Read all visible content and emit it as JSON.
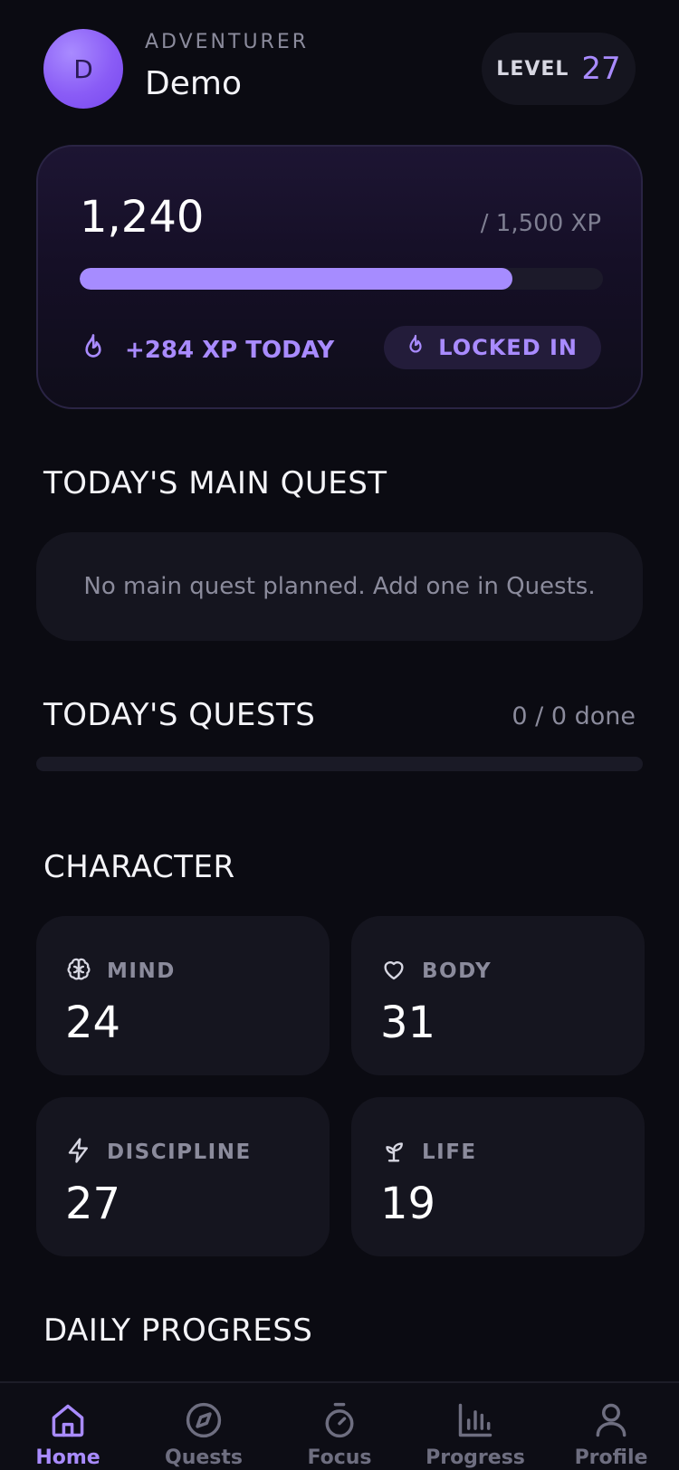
{
  "header": {
    "avatar_initial": "D",
    "role": "ADVENTURER",
    "username": "Demo",
    "level_label": "LEVEL",
    "level_value": "27"
  },
  "xp_card": {
    "current": "1,240",
    "total": "/ 1,500 XP",
    "progress_fraction": 0.827,
    "today": "+284 XP TODAY",
    "status_badge": "LOCKED IN"
  },
  "main_quest": {
    "title": "TODAY'S MAIN QUEST",
    "empty_message": "No main quest planned. Add one in Quests."
  },
  "quests": {
    "title": "TODAY'S QUESTS",
    "count": "0 / 0 done",
    "progress_fraction": 0
  },
  "character": {
    "title": "CHARACTER",
    "stats": [
      {
        "label": "MIND",
        "value": "24",
        "icon": "brain-icon"
      },
      {
        "label": "BODY",
        "value": "31",
        "icon": "heart-icon"
      },
      {
        "label": "DISCIPLINE",
        "value": "27",
        "icon": "lightning-icon"
      },
      {
        "label": "LIFE",
        "value": "19",
        "icon": "sprout-icon"
      }
    ]
  },
  "daily_progress": {
    "title": "DAILY PROGRESS"
  },
  "nav": {
    "items": [
      {
        "label": "Home",
        "icon": "home-icon",
        "active": true
      },
      {
        "label": "Quests",
        "icon": "compass-icon",
        "active": false
      },
      {
        "label": "Focus",
        "icon": "stopwatch-icon",
        "active": false
      },
      {
        "label": "Progress",
        "icon": "bar-chart-icon",
        "active": false
      },
      {
        "label": "Profile",
        "icon": "user-icon",
        "active": false
      }
    ]
  },
  "colors": {
    "accent": "#a98bff",
    "background": "#0b0b12",
    "card": "#15151f",
    "muted_text": "#8b8b9c"
  }
}
